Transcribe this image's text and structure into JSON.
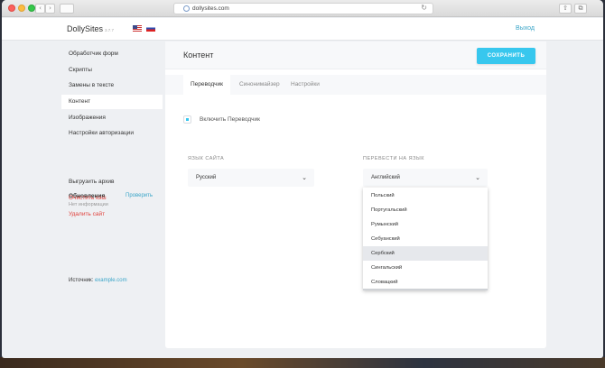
{
  "browser": {
    "url": "dollysites.com",
    "back_icon": "‹",
    "forward_icon": "›",
    "reload_icon": "↻",
    "share_icon": "⇧",
    "tabs_icon": "⧉"
  },
  "header": {
    "brand": "DollySites",
    "version": "3.7.7",
    "logout_label": "Выход"
  },
  "sidebar": {
    "items": [
      {
        "label": "Обработчик форм"
      },
      {
        "label": "Скрипты"
      },
      {
        "label": "Замены в тексте"
      },
      {
        "label": "Контент"
      },
      {
        "label": "Изображения"
      },
      {
        "label": "Настройки авторизации"
      }
    ],
    "updates_label": "Обновления",
    "check_label": "Проверить",
    "no_info": "Нет информации",
    "download_archive": "Выгрузить архив",
    "clear_cache": "Очистить кэш",
    "delete_site": "Удалить сайт",
    "source_label": "Источник:",
    "source_link": "example.com"
  },
  "main": {
    "title": "Контент",
    "save_label": "СОХРАНИТЬ",
    "tabs": [
      {
        "label": "Переводчик"
      },
      {
        "label": "Синонимайзер"
      },
      {
        "label": "Настройки"
      }
    ],
    "enable_translator": "Включить Переводчик",
    "site_lang_label": "ЯЗЫК САЙТА",
    "site_lang_value": "Русский",
    "translate_to_label": "ПЕРЕВЕСТИ НА ЯЗЫК",
    "translate_to_value": "Английский",
    "chevron": "⌄",
    "options": [
      {
        "label": "Польский"
      },
      {
        "label": "Португальский"
      },
      {
        "label": "Румынский"
      },
      {
        "label": "Себуанский"
      },
      {
        "label": "Сербский"
      },
      {
        "label": "Сингальский"
      },
      {
        "label": "Словацкий"
      }
    ],
    "highlighted_option": "Сербский"
  },
  "colors": {
    "accent": "#37c7ee",
    "link": "#3aa5c8",
    "danger": "#e0433e"
  }
}
